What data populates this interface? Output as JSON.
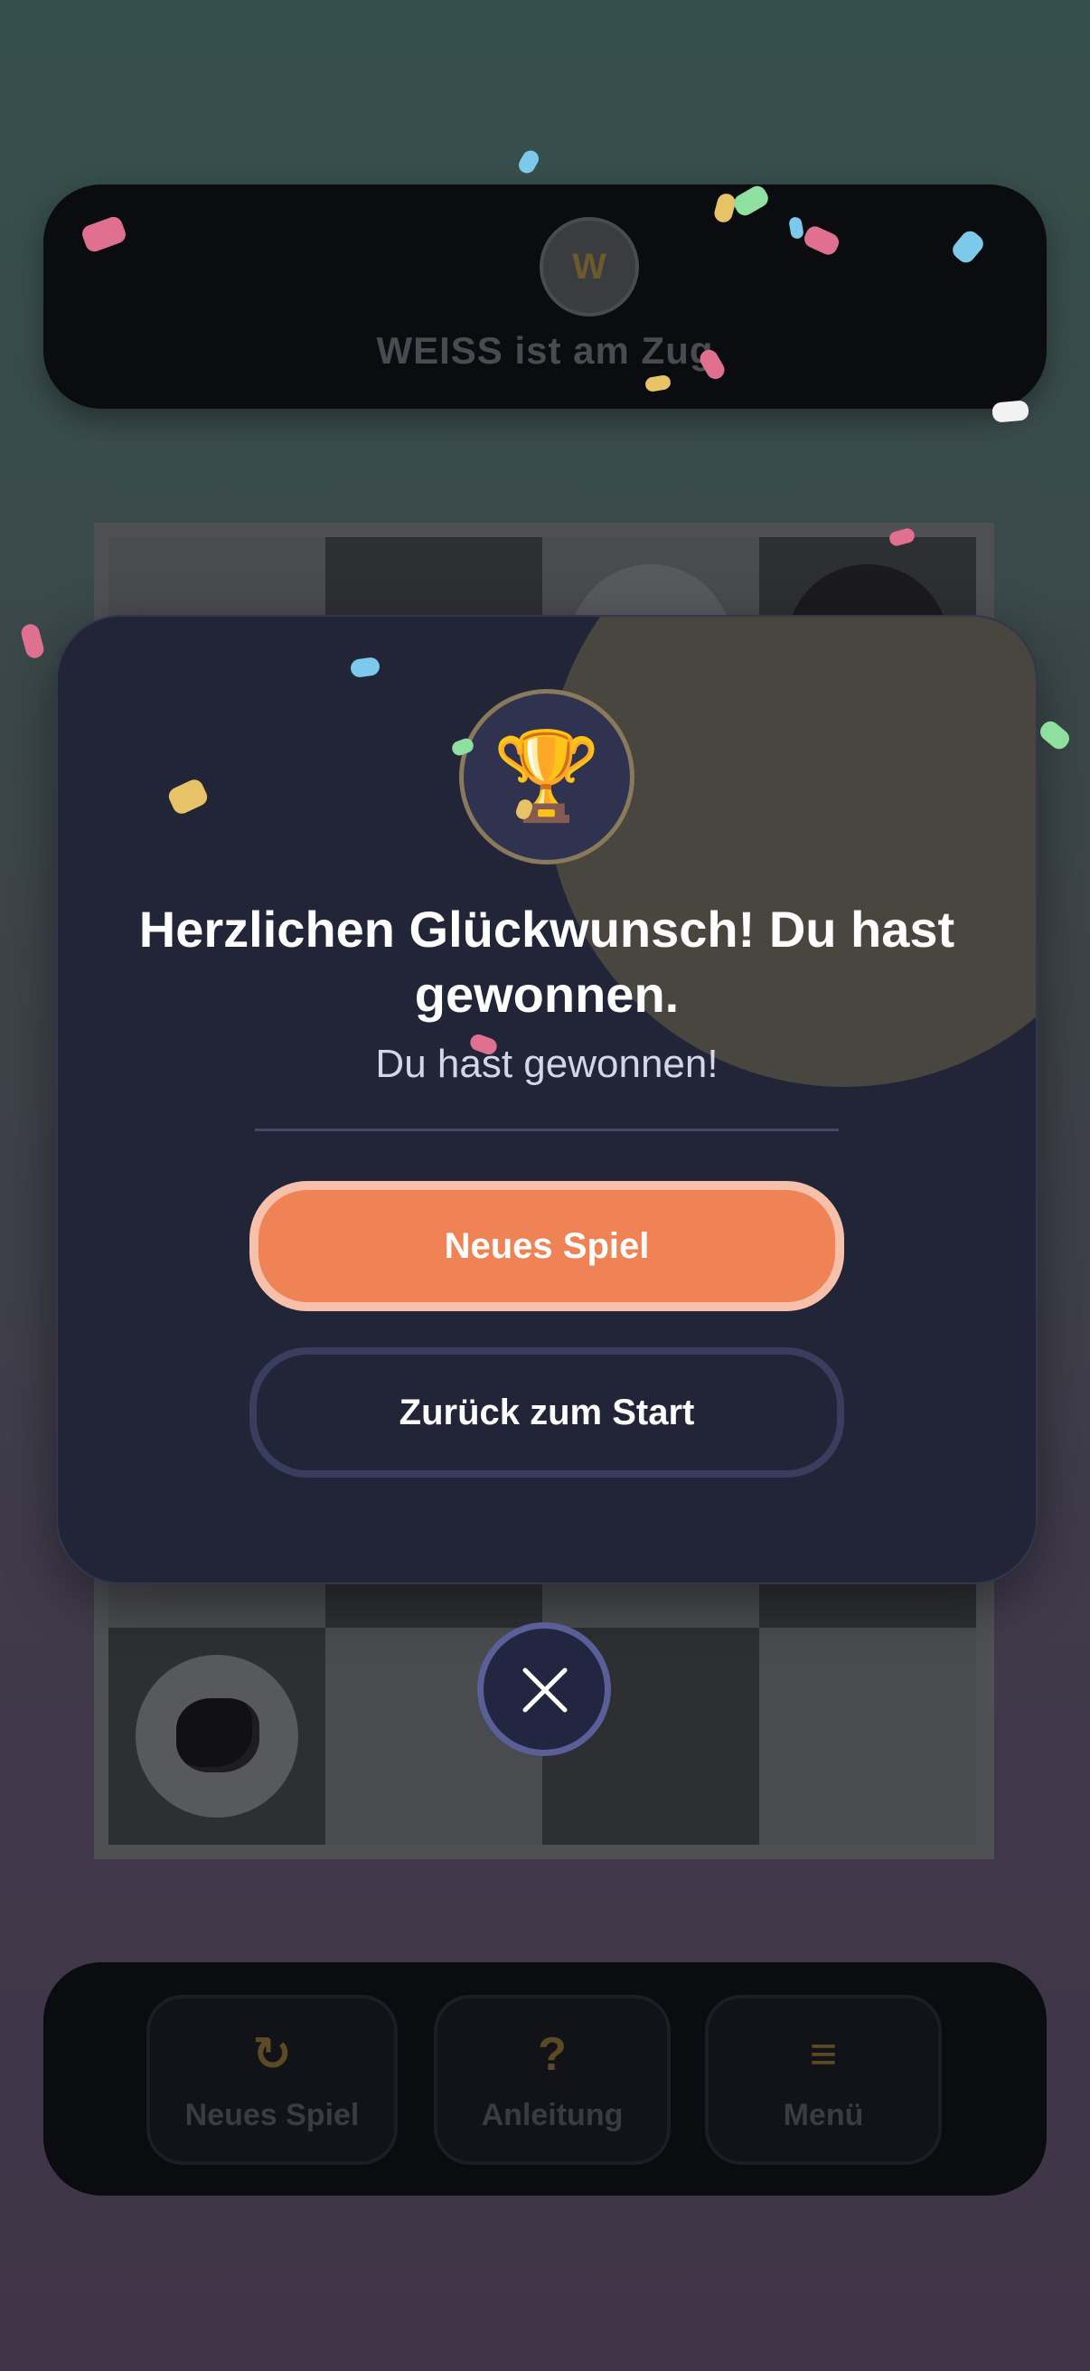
{
  "status": {
    "player_initial": "W",
    "turn_text": "WEISS ist am Zug"
  },
  "modal": {
    "trophy": "🏆",
    "title": "Herzlichen Glückwunsch! Du hast gewonnen.",
    "subtitle": "Du hast gewonnen!",
    "primary_button": "Neues Spiel",
    "secondary_button": "Zurück zum Start"
  },
  "nav": {
    "items": [
      {
        "icon": "↻",
        "icon_name": "restart-icon",
        "label": "Neues Spiel"
      },
      {
        "icon": "?",
        "icon_name": "help-icon",
        "label": "Anleitung"
      },
      {
        "icon": "≡",
        "icon_name": "menu-icon",
        "label": "Menü"
      }
    ]
  },
  "colors": {
    "accent": "#ef8355",
    "modal_bg": "#222538",
    "close_ring": "#5a5f98"
  }
}
